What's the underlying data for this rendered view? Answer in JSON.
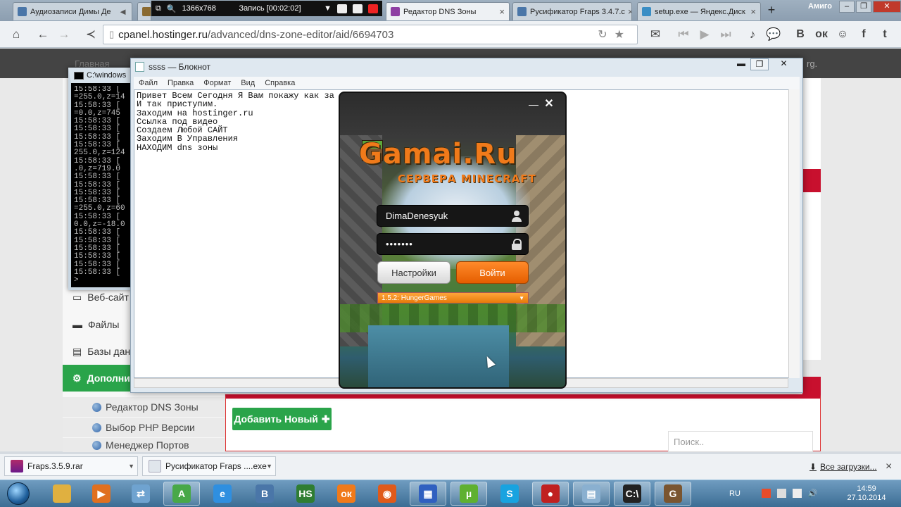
{
  "browser": {
    "tabs": [
      {
        "label": "Аудиозаписи Димы Де",
        "color": "#4a76a8"
      },
      {
        "label": "Редактор DNS Зоны",
        "color": "#8e3fa3"
      },
      {
        "label": "Русификатор Fraps 3.4.7.с",
        "color": "#4a76a8"
      },
      {
        "label": "setup.exe — Яндекс.Диск",
        "color": "#3a8ec5"
      }
    ],
    "new_tab_symbol": "+",
    "user": "Амиго",
    "address": {
      "host": "cpanel.hostinger.ru",
      "path": "/advanced/dns-zone-editor/aid/6694703"
    },
    "social": [
      "В",
      "ок",
      "f",
      "t"
    ]
  },
  "recorder": {
    "resolution": "1366x768",
    "status": "Запись [00:02:02]"
  },
  "page": {
    "nav_faint": "Главная",
    "sidebar": [
      {
        "label": "Веб-сайт"
      },
      {
        "label": "Файлы"
      },
      {
        "label": "Базы дан"
      },
      {
        "label": "Дополни",
        "active": true
      }
    ],
    "subitems": [
      {
        "label": "Редактор DNS Зоны"
      },
      {
        "label": "Выбор PHP Версии"
      },
      {
        "label": "Менеджер Портов"
      }
    ],
    "add_button": "Добавить Новый",
    "search_placeholder": "Поиск..",
    "right_fragment": "rg."
  },
  "cmd": {
    "title": "C:\\windows",
    "lines": [
      "15:58:33 [",
      "=255.0,z=14",
      "15:58:33 [",
      "=0.0,z=745",
      "15:58:33 [",
      "15:58:33 [",
      "15:58:33 [",
      "15:58:33 [",
      "255.0,z=124",
      "15:58:33 [",
      ".0,z=719.0",
      "15:58:33 [",
      "15:58:33 [",
      "15:58:33 [",
      "15:58:33 [",
      "=255.0,z=60",
      "15:58:33 [",
      "0.0,z=-18.0",
      "15:58:33 [",
      "15:58:33 [",
      "15:58:33 [",
      "15:58:33 [",
      "15:58:33 [",
      "15:58:33 [",
      ">"
    ]
  },
  "notepad": {
    "title": "ssss — Блокнот",
    "menu": [
      "Файл",
      "Правка",
      "Формат",
      "Вид",
      "Справка"
    ],
    "text": "Привет Всем Сегодня Я Вам покажу как за                                          та.\nИ так приступим.\nЗаходим на hostinger.ru\nСсылка под видео\nСоздаем Любой САЙТ\nЗаходим В Управления\nНАХОДИМ dns зоны"
  },
  "launcher": {
    "logo": "Gamai.Ru",
    "subtitle": "СЕРВЕРА MINECRAFT",
    "username": "DimaDenesyuk",
    "password": "•••••••",
    "settings_button": "Настройки",
    "login_button": "Войти",
    "server": "1.5.2: HungerGames"
  },
  "downloads": {
    "items": [
      "Fraps.3.5.9.rar",
      "Русификатор Fraps ....exe"
    ],
    "all_link": "Все загрузки..."
  },
  "taskbar": {
    "apps": [
      {
        "name": "explorer",
        "color": "#e0b040",
        "glyph": ""
      },
      {
        "name": "media",
        "color": "#e07020",
        "glyph": "▶"
      },
      {
        "name": "network",
        "color": "#6fa3d0",
        "glyph": "⇄"
      },
      {
        "name": "avast",
        "color": "#48a848",
        "glyph": "A"
      },
      {
        "name": "ie",
        "color": "#2f8fe0",
        "glyph": "e"
      },
      {
        "name": "vk",
        "color": "#4a76a8",
        "glyph": "B"
      },
      {
        "name": "hs",
        "color": "#2f7d32",
        "glyph": "HS"
      },
      {
        "name": "ok",
        "color": "#f07a1a",
        "glyph": "ок"
      },
      {
        "name": "firefox",
        "color": "#e05a1a",
        "glyph": "◉"
      },
      {
        "name": "hardware",
        "color": "#3060c0",
        "glyph": "▦"
      },
      {
        "name": "utorrent",
        "color": "#5fb030",
        "glyph": "µ"
      },
      {
        "name": "skype",
        "color": "#18a3e0",
        "glyph": "S"
      },
      {
        "name": "fraps",
        "color": "#c02020",
        "glyph": "●"
      },
      {
        "name": "notepad",
        "color": "#8ab0d0",
        "glyph": "▤"
      },
      {
        "name": "cmd",
        "color": "#222222",
        "glyph": "C:\\"
      },
      {
        "name": "minecraft",
        "color": "#7a5530",
        "glyph": "G"
      }
    ],
    "lang": "RU",
    "time": "14:59",
    "date": "27.10.2014"
  }
}
